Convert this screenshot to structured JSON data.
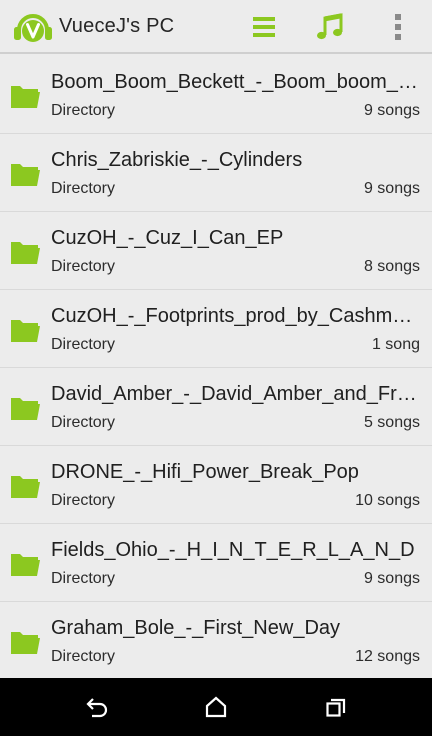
{
  "appbar": {
    "title": "VueceJ's PC",
    "logo_icon": "vuece-logo-icon",
    "actions": [
      {
        "icon": "list-icon"
      },
      {
        "icon": "music-note-icon"
      },
      {
        "icon": "overflow-menu-icon"
      }
    ],
    "accent_color": "#8cc820"
  },
  "items": [
    {
      "name": "Boom_Boom_Beckett_-_Boom_boom_Beckett",
      "type": "Directory",
      "count": "9 songs"
    },
    {
      "name": "Chris_Zabriskie_-_Cylinders",
      "type": "Directory",
      "count": "9 songs"
    },
    {
      "name": "CuzOH_-_Cuz_I_Can_EP",
      "type": "Directory",
      "count": "8 songs"
    },
    {
      "name": "CuzOH_-_Footprints_prod_by_Cashmere",
      "type": "Directory",
      "count": "1 song"
    },
    {
      "name": "David_Amber_-_David_Amber_and_Friends",
      "type": "Directory",
      "count": "5 songs"
    },
    {
      "name": "DRONE_-_Hifi_Power_Break_Pop",
      "type": "Directory",
      "count": "10 songs"
    },
    {
      "name": "Fields_Ohio_-_H_I_N_T_E_R_L_A_N_D",
      "type": "Directory",
      "count": "9 songs"
    },
    {
      "name": "Graham_Bole_-_First_New_Day",
      "type": "Directory",
      "count": "12 songs"
    }
  ],
  "navbar": {
    "buttons": [
      {
        "icon": "back-icon"
      },
      {
        "icon": "home-icon"
      },
      {
        "icon": "recents-icon"
      }
    ]
  }
}
